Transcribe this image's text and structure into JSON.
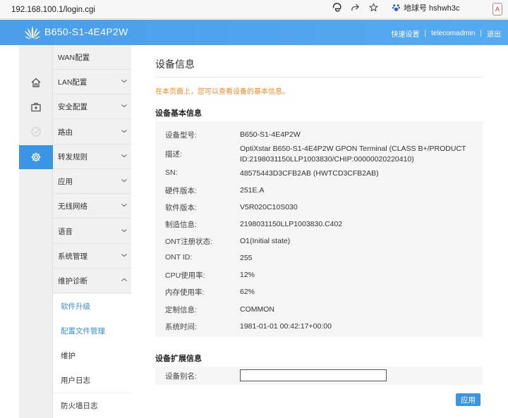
{
  "browser": {
    "url": "192.168.100.1/login.cgi",
    "search_hint": "地球号 hshwh3c",
    "ext_badge": "A"
  },
  "header": {
    "model": "B650-S1-4E4P2W",
    "links": [
      "快速设置",
      "telecomadmin",
      "退出"
    ]
  },
  "rail": {
    "icons": [
      "home-icon",
      "medkit-icon",
      "speed-icon",
      "gear-icon"
    ],
    "active_index": 3
  },
  "menu": {
    "items": [
      {
        "label": "WAN配置",
        "has_chevron": false
      },
      {
        "label": "LAN配置",
        "has_chevron": true
      },
      {
        "label": "安全配置",
        "has_chevron": true
      },
      {
        "label": "路由",
        "has_chevron": true
      },
      {
        "label": "转发规则",
        "has_chevron": true
      },
      {
        "label": "应用",
        "has_chevron": true
      },
      {
        "label": "无线网络",
        "has_chevron": true
      },
      {
        "label": "语音",
        "has_chevron": true
      },
      {
        "label": "系统管理",
        "has_chevron": true
      },
      {
        "label": "维护诊断",
        "has_chevron": true,
        "expanded": true
      }
    ],
    "subitems": [
      {
        "label": "软件升级",
        "link": true
      },
      {
        "label": "配置文件管理",
        "link": true
      },
      {
        "label": "维护",
        "link": false
      },
      {
        "label": "用户日志",
        "link": false
      },
      {
        "label": "防火墙日志",
        "link": false
      }
    ]
  },
  "main": {
    "title": "设备信息",
    "notice": "在本页面上，您可以查看设备的基本信息。",
    "basic_title": "设备基本信息",
    "basic_rows": [
      {
        "label": "设备型号:",
        "value": "B650-S1-4E4P2W"
      },
      {
        "label": "描述:",
        "value": "OptiXstar B650-S1-4E4P2W GPON Terminal (CLASS B+/PRODUCT ID:2198031150LLP1003830/CHIP:00000020220410)"
      },
      {
        "label": "SN:",
        "value": "48575443D3CFB2AB (HWTCD3CFB2AB)"
      },
      {
        "label": "硬件版本:",
        "value": "251E.A"
      },
      {
        "label": "软件版本:",
        "value": "V5R020C10S030"
      },
      {
        "label": "制造信息:",
        "value": "2198031150LLP1003830.C402"
      },
      {
        "label": "ONT注册状态:",
        "value": "O1(Initial state)"
      },
      {
        "label": "ONT ID:",
        "value": "255"
      },
      {
        "label": "CPU使用率:",
        "value": "12%"
      },
      {
        "label": "内存使用率:",
        "value": "62%"
      },
      {
        "label": "定制信息:",
        "value": "COMMON"
      },
      {
        "label": "系统时间:",
        "value": "1981-01-01 00:42:17+00:00"
      }
    ],
    "ext_title": "设备扩展信息",
    "alias_label": "设备别名:",
    "alias_value": "",
    "apply_label": "应用"
  },
  "colors": {
    "header": "#4a9eea",
    "accent": "#3a95e4",
    "notice": "#f08a24"
  }
}
